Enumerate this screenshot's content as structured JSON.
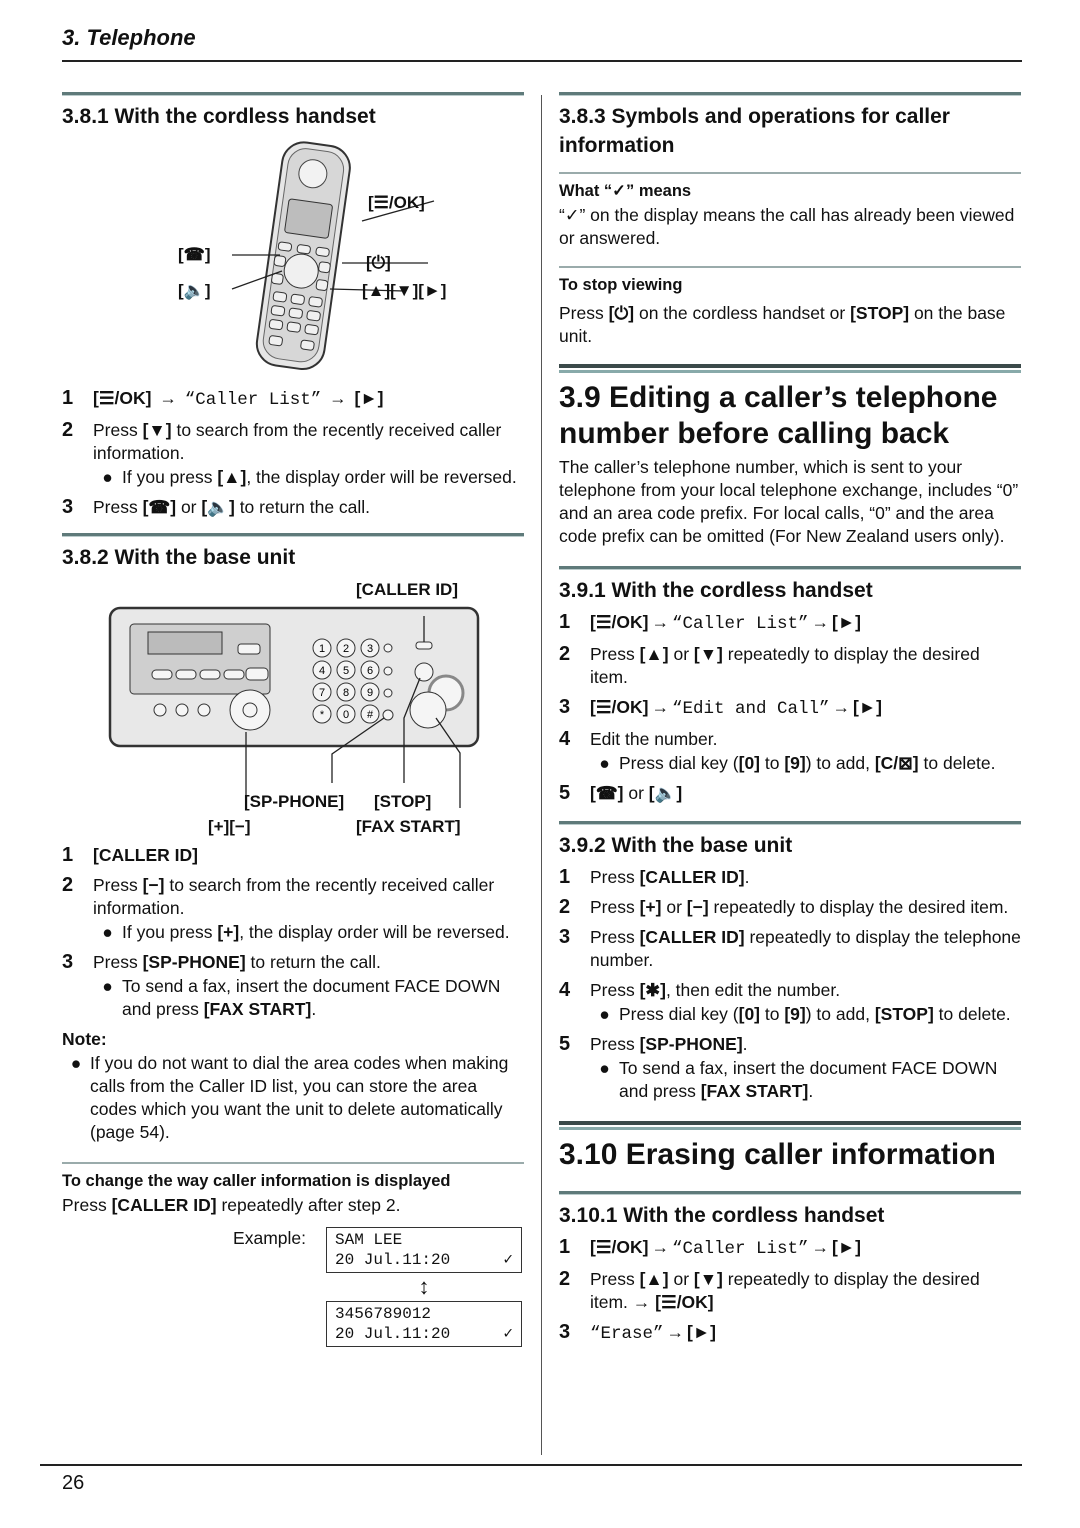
{
  "header": {
    "chapter": "3. Telephone"
  },
  "footer": {
    "page_number": "26"
  },
  "left": {
    "s381": {
      "title": "3.8.1 With the cordless handset",
      "figure_labels": {
        "menu_ok": "[☰/OK]",
        "talk": "[☎]",
        "off": "[⏻]",
        "speaker": "[🔈]",
        "nav": "[▲][▼][►]"
      },
      "steps": [
        {
          "num": "1",
          "key1": "[☰/OK]",
          "arrow": "→",
          "text": "“Caller List”",
          "key2": "[►]"
        },
        {
          "num": "2",
          "pre": "Press ",
          "key": "[▼]",
          "post": " to search from the recently received caller information.",
          "bullet": {
            "pre": "If you press ",
            "key": "[▲]",
            "post": ", the display order will be reversed."
          }
        },
        {
          "num": "3",
          "pre": "Press ",
          "key1": "[☎]",
          "mid": " or ",
          "key2": "[🔈]",
          "post": " to return the call."
        }
      ]
    },
    "s382": {
      "title": "3.8.2 With the base unit",
      "figure_labels": {
        "caller_id": "[CALLER ID]",
        "sp_phone": "[SP-PHONE]",
        "stop": "[STOP]",
        "plus_minus": "[+][−]",
        "fax_start": "[FAX START]"
      },
      "keypad": [
        "1",
        "2",
        "3",
        "4",
        "5",
        "6",
        "7",
        "8",
        "9",
        "*",
        "0",
        "#"
      ],
      "steps": [
        {
          "num": "1",
          "key": "[CALLER ID]"
        },
        {
          "num": "2",
          "pre": "Press ",
          "key": "[−]",
          "post": " to search from the recently received caller information.",
          "bullet": {
            "pre": "If you press ",
            "key": "[+]",
            "post": ", the display order will be reversed."
          }
        },
        {
          "num": "3",
          "pre": "Press ",
          "key": "[SP-PHONE]",
          "post": " to return the call.",
          "bullet": {
            "pre": "To send a fax, insert the document FACE DOWN and press ",
            "key": "[FAX START]",
            "post": "."
          }
        }
      ],
      "note": {
        "label": "Note:",
        "text": "If you do not want to dial the area codes when making calls from the Caller ID list, you can store the area codes which you want the unit to delete automatically (page 54)."
      }
    },
    "change_display": {
      "heading": "To change the way caller information is displayed",
      "pre": "Press ",
      "key": "[CALLER ID]",
      "post": " repeatedly after step 2.",
      "example_label": "Example:",
      "lcd1": {
        "line1": "SAM LEE",
        "line2": "20 Jul.11:20",
        "mark": "✓"
      },
      "swap_icon": "↕",
      "lcd2": {
        "line1": "3456789012",
        "line2": "20 Jul.11:20",
        "mark": "✓"
      }
    }
  },
  "right": {
    "s383": {
      "title": "3.8.3 Symbols and operations for caller information",
      "what_heading": "What “✓” means",
      "what_text": "“✓” on the display means the call has already been viewed or answered.",
      "stop_heading": "To stop viewing",
      "stop_pre": "Press ",
      "stop_key1": "[⏻]",
      "stop_mid": " on the cordless handset or ",
      "stop_key2": "[STOP]",
      "stop_post": " on the base unit."
    },
    "s39": {
      "title": "3.9 Editing a caller’s telephone number before calling back",
      "intro": "The caller’s telephone number, which is sent to your telephone from your local telephone exchange, includes “0” and an area code prefix. For local calls, “0” and the area code prefix can be omitted (For New Zealand users only)."
    },
    "s391": {
      "title": "3.9.1 With the cordless handset",
      "steps": [
        {
          "num": "1",
          "key1": "[☰/OK]",
          "arrow": "→",
          "text": "“Caller List”",
          "key2": "[►]"
        },
        {
          "num": "2",
          "pre": "Press ",
          "key1": "[▲]",
          "mid": " or ",
          "key2": "[▼]",
          "post": " repeatedly to display the desired item."
        },
        {
          "num": "3",
          "key1": "[☰/OK]",
          "arrow": "→",
          "text": "“Edit and Call”",
          "key2": "[►]"
        },
        {
          "num": "4",
          "text": "Edit the number.",
          "bullet": {
            "pre": "Press dial key (",
            "key1": "[0]",
            "mid": " to ",
            "key2": "[9]",
            "mid2": ") to add, ",
            "key3": "[C/⊠]",
            "post": " to delete."
          }
        },
        {
          "num": "5",
          "key1": "[☎]",
          "mid": " or ",
          "key2": "[🔈]"
        }
      ]
    },
    "s392": {
      "title": "3.9.2 With the base unit",
      "steps": [
        {
          "num": "1",
          "pre": "Press ",
          "key": "[CALLER ID]",
          "post": "."
        },
        {
          "num": "2",
          "pre": "Press ",
          "key1": "[+]",
          "mid": " or ",
          "key2": "[−]",
          "post": " repeatedly to display the desired item."
        },
        {
          "num": "3",
          "pre": "Press ",
          "key": "[CALLER ID]",
          "post": " repeatedly to display the telephone number."
        },
        {
          "num": "4",
          "pre": "Press ",
          "key": "[✱]",
          "post": ", then edit the number.",
          "bullet": {
            "pre": "Press dial key (",
            "key1": "[0]",
            "mid": " to ",
            "key2": "[9]",
            "mid2": ") to add, ",
            "key3": "[STOP]",
            "post": " to delete."
          }
        },
        {
          "num": "5",
          "pre": "Press ",
          "key": "[SP-PHONE]",
          "post": ".",
          "bullet": {
            "pre": "To send a fax, insert the document FACE DOWN and press ",
            "key": "[FAX START]",
            "post": "."
          }
        }
      ]
    },
    "s310": {
      "title": "3.10 Erasing caller information"
    },
    "s3101": {
      "title": "3.10.1 With the cordless handset",
      "steps": [
        {
          "num": "1",
          "key1": "[☰/OK]",
          "arrow": "→",
          "text": "“Caller List”",
          "key2": "[►]"
        },
        {
          "num": "2",
          "pre": "Press ",
          "key1": "[▲]",
          "mid": " or ",
          "key2": "[▼]",
          "post": " repeatedly to display the desired item.",
          "arrow": " → ",
          "key3": "[☰/OK]"
        },
        {
          "num": "3",
          "text": "“Erase”",
          "arrow": "→",
          "key2": "[►]"
        }
      ]
    }
  }
}
